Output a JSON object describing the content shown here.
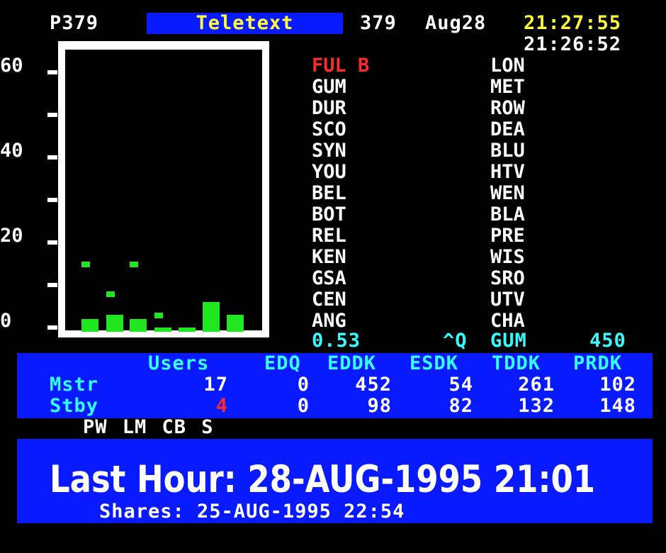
{
  "header": {
    "page": "P379",
    "service": "Teletext",
    "page_num": "379",
    "date": "Aug28",
    "clock": "21:27:55",
    "clock2": "21:26:52"
  },
  "graph": {
    "y_labels": [
      "60",
      "40",
      "20",
      "0"
    ],
    "y_range": [
      0,
      60
    ],
    "columns": [
      {
        "levels": [
          3,
          15
        ]
      },
      {
        "levels": [
          4,
          8
        ]
      },
      {
        "levels": [
          3,
          15
        ]
      },
      {
        "levels": [
          1,
          3
        ]
      },
      {
        "levels": [
          1
        ]
      },
      {
        "levels": [
          7
        ]
      },
      {
        "levels": [
          4
        ]
      },
      {
        "levels": [
          1
        ]
      }
    ]
  },
  "codes": {
    "left": [
      {
        "code": "FUL B",
        "color": "#ff2a2a"
      },
      {
        "code": "GUM",
        "color": "#ffffff"
      },
      {
        "code": "DUR",
        "color": "#ffffff"
      },
      {
        "code": "SCO",
        "color": "#ffffff"
      },
      {
        "code": "SYN",
        "color": "#ffffff"
      },
      {
        "code": "YOU",
        "color": "#ffffff"
      },
      {
        "code": "BEL",
        "color": "#ffffff"
      },
      {
        "code": "BOT",
        "color": "#ffffff"
      },
      {
        "code": "REL",
        "color": "#ffffff"
      },
      {
        "code": "KEN",
        "color": "#ffffff"
      },
      {
        "code": "GSA",
        "color": "#ffffff"
      },
      {
        "code": "CEN",
        "color": "#ffffff"
      },
      {
        "code": "ANG",
        "color": "#ffffff"
      }
    ],
    "right": [
      "LON",
      "MET",
      "ROW",
      "DEA",
      "BLU",
      "HTV",
      "WEN",
      "BLA",
      "PRE",
      "WIS",
      "SRO",
      "UTV",
      "CHA"
    ]
  },
  "summary_line": {
    "value": "0.53",
    "key": "^Q",
    "code": "GUM",
    "count": "450"
  },
  "stats": {
    "headers": [
      "Users",
      "EDQ",
      "EDDK",
      "ESDK",
      "TDDK",
      "PRDK"
    ],
    "rows": [
      {
        "label": "Mstr",
        "values": [
          "17",
          "0",
          "452",
          "54",
          "261",
          "102"
        ]
      },
      {
        "label": "Stby",
        "values": [
          "4",
          "0",
          "98",
          "82",
          "132",
          "148"
        ]
      }
    ]
  },
  "flags": "PW LM CB S",
  "footer": {
    "last_hour": "Last Hour: 28-AUG-1995 21:01",
    "shares": "Shares: 25-AUG-1995 22:54"
  },
  "colors": {
    "blue": "#0a1aff",
    "yellow": "#ffff33",
    "red": "#ff2a2a",
    "cyan": "#33ffff",
    "green": "#1fe61f"
  }
}
